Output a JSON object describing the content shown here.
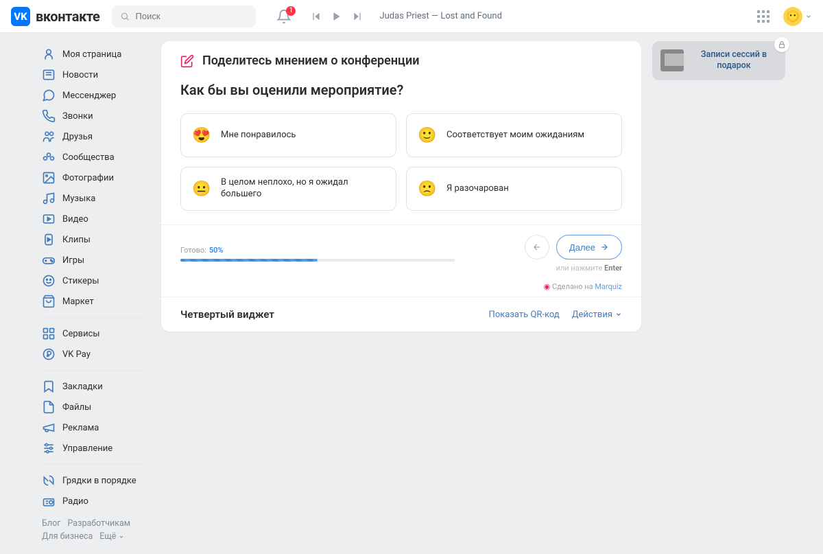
{
  "header": {
    "brand": "вконтакте",
    "search_placeholder": "Поиск",
    "notif_count": "1",
    "track": "Judas Priest — Lost and Found"
  },
  "sidebar": {
    "items": [
      "Моя страница",
      "Новости",
      "Мессенджер",
      "Звонки",
      "Друзья",
      "Сообщества",
      "Фотографии",
      "Музыка",
      "Видео",
      "Клипы",
      "Игры",
      "Стикеры",
      "Маркет"
    ],
    "group2": [
      "Сервисы",
      "VK Pay"
    ],
    "group3": [
      "Закладки",
      "Файлы",
      "Реклама",
      "Управление"
    ],
    "group4": [
      "Грядки в порядке",
      "Радио"
    ],
    "footer": {
      "blog": "Блог",
      "devs": "Разработчикам",
      "biz": "Для бизнеса",
      "more": "Ещё"
    }
  },
  "survey": {
    "title": "Поделитесь мнением о конференции",
    "question": "Как бы вы оценили мероприятие?",
    "options": [
      {
        "emoji": "😍",
        "text": "Мне понравилось"
      },
      {
        "emoji": "🙂",
        "text": "Соответствует моим ожиданиям"
      },
      {
        "emoji": "😐",
        "text": "В целом неплохо, но я ожидал большего"
      },
      {
        "emoji": "🙁",
        "text": "Я разочарован"
      }
    ],
    "progress_label": "Готово:",
    "progress_pct": "50%",
    "progress_value": 50,
    "back": "←",
    "next": "Далее",
    "hint_prefix": "или нажмите ",
    "hint_key": "Enter",
    "made_prefix": "Сделано на ",
    "made_brand": "Marquiz"
  },
  "promo": {
    "text": "Записи сессий в подарок"
  },
  "widget": {
    "title": "Четвертый виджет",
    "qr": "Показать QR-код",
    "actions": "Действия"
  }
}
